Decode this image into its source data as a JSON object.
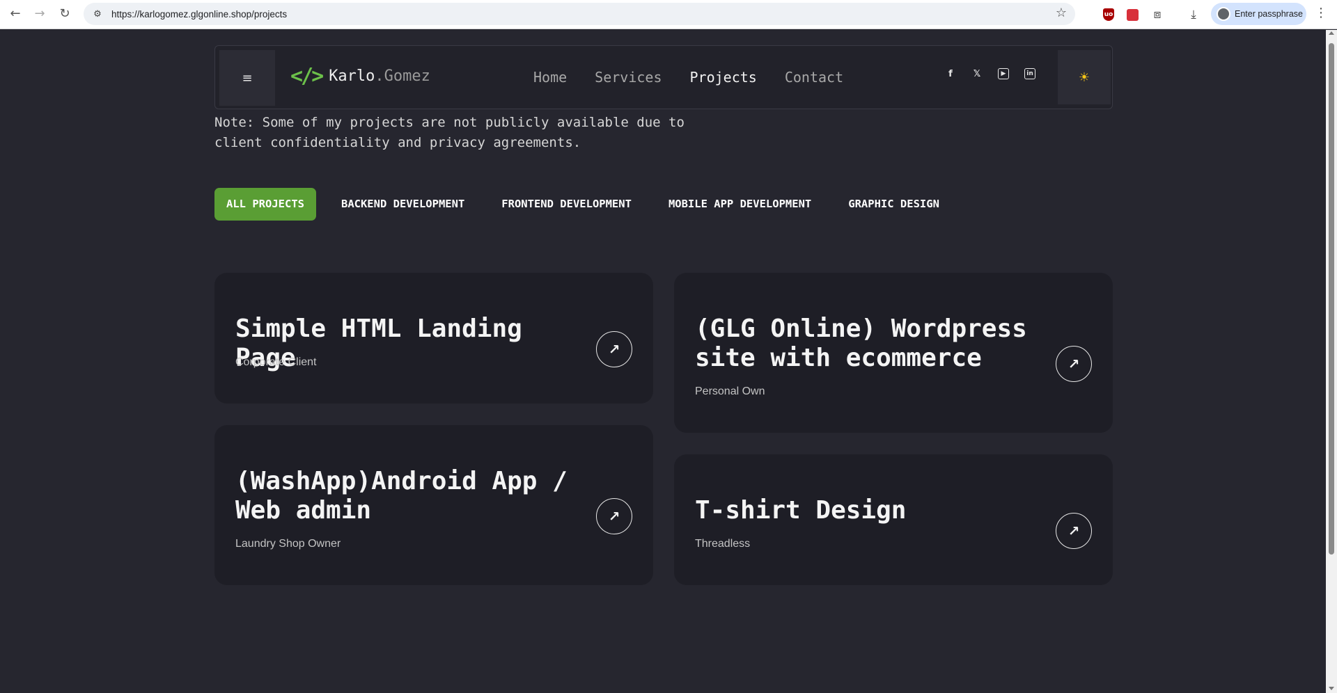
{
  "browser": {
    "url": "https://karlogomez.glgonline.shop/projects",
    "profile_label": "Enter passphrase",
    "ublock_label": "uo"
  },
  "header": {
    "logo_icon": "</>",
    "logo_first": "Karlo",
    "logo_dot": ".",
    "logo_last": "Gomez",
    "nav": [
      {
        "label": "Home"
      },
      {
        "label": "Services"
      },
      {
        "label": "Projects"
      },
      {
        "label": "Contact"
      }
    ],
    "socials": [
      "facebook-icon",
      "x-icon",
      "youtube-icon",
      "linkedin-icon"
    ]
  },
  "note": "Note: Some of my projects are not publicly available due to client confidentiality and privacy agreements.",
  "filters": [
    {
      "label": "ALL PROJECTS",
      "active": true
    },
    {
      "label": "BACKEND DEVELOPMENT"
    },
    {
      "label": "FRONTEND DEVELOPMENT"
    },
    {
      "label": "MOBILE APP DEVELOPMENT"
    },
    {
      "label": "GRAPHIC DESIGN"
    }
  ],
  "projects": [
    {
      "title": "Simple HTML Landing Page",
      "client": "Corporate Client"
    },
    {
      "title": "(GLG Online) Wordpress site with ecommerce",
      "client": "Personal Own"
    },
    {
      "title": "(WashApp)Android App / Web admin",
      "client": "Laundry Shop Owner"
    },
    {
      "title": "T-shirt Design",
      "client": "Threadless"
    }
  ],
  "colors": {
    "accent": "#6cc04a",
    "filter_active": "#5a9e34",
    "background": "#26262f",
    "card": "#1e1e26"
  }
}
